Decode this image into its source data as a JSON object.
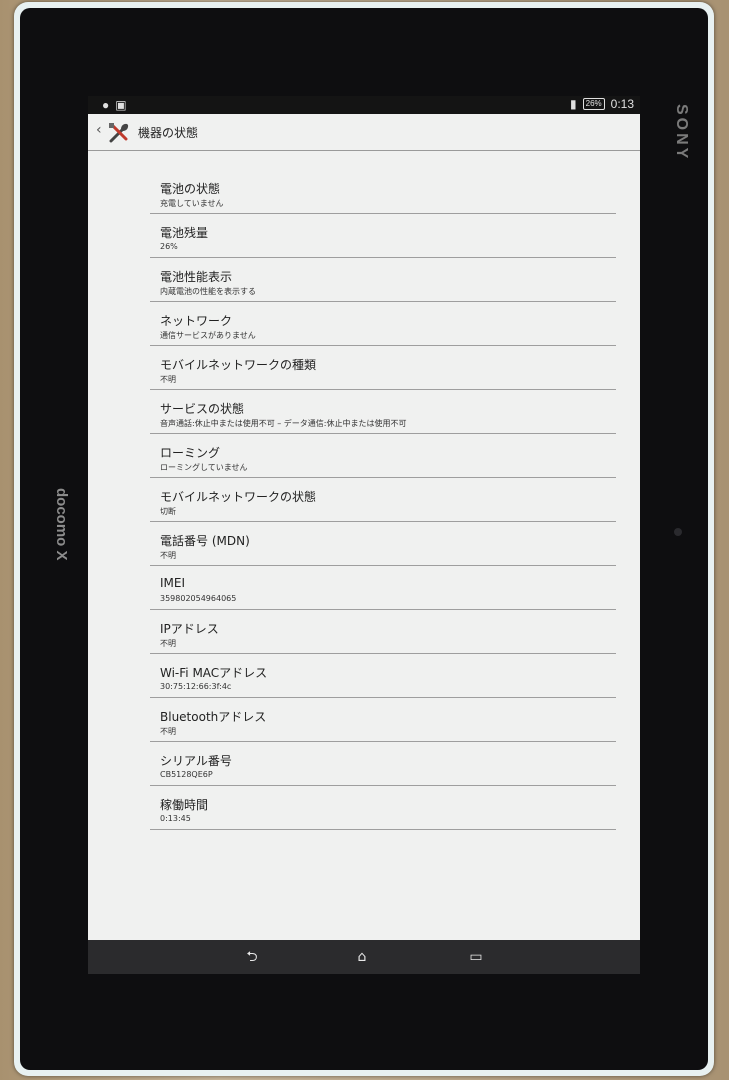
{
  "device": {
    "brand": "SONY",
    "carrier": "docomo X"
  },
  "status_bar": {
    "left_icons": [
      "alert-icon",
      "notification-icon"
    ],
    "battery": "26%",
    "time": "0:13"
  },
  "action_bar": {
    "title": "機器の状態"
  },
  "items": [
    {
      "title": "電池の状態",
      "summary": "充電していません"
    },
    {
      "title": "電池残量",
      "summary": "26%"
    },
    {
      "title": "電池性能表示",
      "summary": "内蔵電池の性能を表示する"
    },
    {
      "title": "ネットワーク",
      "summary": "通信サービスがありません"
    },
    {
      "title": "モバイルネットワークの種類",
      "summary": "不明"
    },
    {
      "title": "サービスの状態",
      "summary": "音声通話:休止中または使用不可 – データ通信:休止中または使用不可"
    },
    {
      "title": "ローミング",
      "summary": "ローミングしていません"
    },
    {
      "title": "モバイルネットワークの状態",
      "summary": "切断"
    },
    {
      "title": "電話番号 (MDN)",
      "summary": "不明"
    },
    {
      "title": "IMEI",
      "summary": "359802054964065"
    },
    {
      "title": "IPアドレス",
      "summary": "不明"
    },
    {
      "title": "Wi-Fi MACアドレス",
      "summary": "30:75:12:66:3f:4c"
    },
    {
      "title": "Bluetoothアドレス",
      "summary": "不明"
    },
    {
      "title": "シリアル番号",
      "summary": "CB5128QE6P"
    },
    {
      "title": "稼働時間",
      "summary": "0:13:45"
    }
  ],
  "nav_bar": {
    "back_glyph": "⮌",
    "home_glyph": "⌂",
    "recents_glyph": "▭"
  }
}
